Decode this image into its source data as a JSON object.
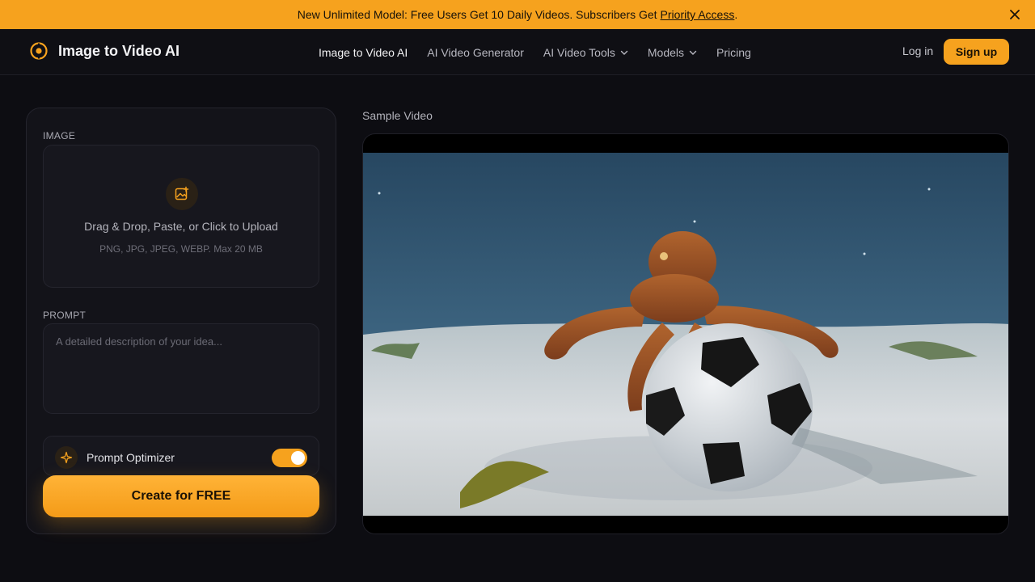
{
  "announcement": {
    "text": "New Unlimited Model: Free Users Get 10 Daily Videos. Subscribers Get",
    "link": "Priority Access",
    "suffix": "."
  },
  "brand": {
    "name": "Image to Video AI",
    "accent": "#f6a21e"
  },
  "nav": {
    "items": [
      {
        "label": "Image to Video AI",
        "active": true
      },
      {
        "label": "AI Video Generator"
      },
      {
        "label": "AI Video Tools",
        "dropdown": true
      },
      {
        "label": "Models",
        "dropdown": true
      },
      {
        "label": "Pricing"
      }
    ],
    "login": "Log in",
    "signup": "Sign up"
  },
  "form": {
    "image_label": "IMAGE",
    "upload_title": "Drag & Drop, Paste, or Click to Upload",
    "upload_sub": "PNG, JPG, JPEG, WEBP. Max 20 MB",
    "prompt_label": "PROMPT",
    "prompt_placeholder": "A detailed description of your idea...",
    "optimizer_label": "Prompt Optimizer",
    "optimizer_on": true,
    "create_label": "Create for FREE"
  },
  "sample": {
    "label": "Sample Video"
  }
}
